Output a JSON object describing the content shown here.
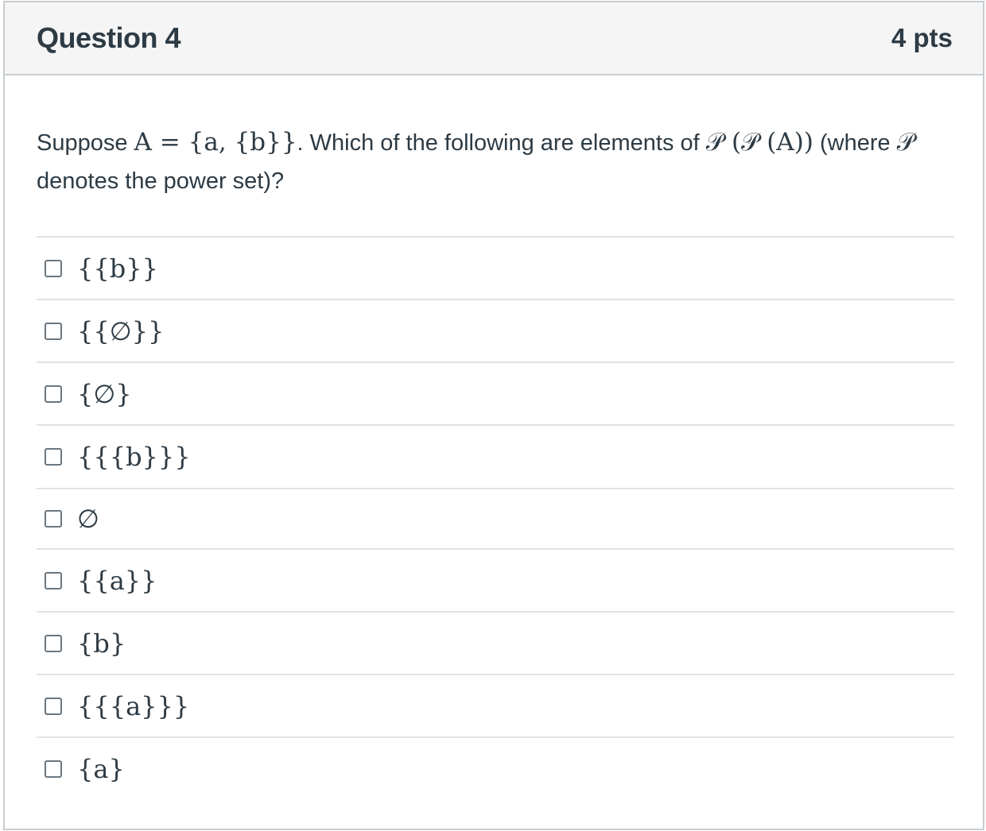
{
  "header": {
    "title": "Question 4",
    "points": "4 pts"
  },
  "question": {
    "text_1": "Suppose ",
    "math_A_eq": "A = {a, {b}}",
    "text_2": ". Which of the following are elements of ",
    "math_PPA": "𝒫 (𝒫 (A))",
    "text_3": " (where ",
    "math_P": "𝒫",
    "text_4": " denotes the power set)?"
  },
  "answers": [
    {
      "label": "{{b}}"
    },
    {
      "label": "{{∅}}"
    },
    {
      "label": "{∅}"
    },
    {
      "label": "{{{b}}}"
    },
    {
      "label": "∅"
    },
    {
      "label": "{{a}}"
    },
    {
      "label": "{b}"
    },
    {
      "label": "{{{a}}}"
    },
    {
      "label": "{a}"
    }
  ]
}
